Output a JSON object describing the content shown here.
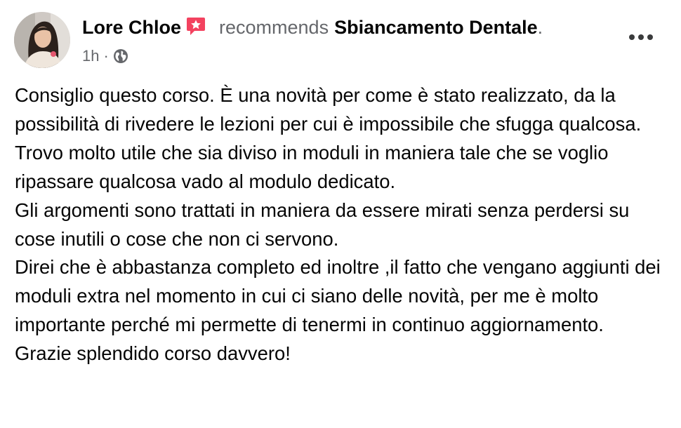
{
  "post": {
    "author": "Lore Chloe",
    "action": "recommends",
    "page": "Sbiancamento Dentale",
    "period": ".",
    "time": "1h",
    "separator": "·",
    "audience_icon": "globe-icon",
    "badge_icon": "recommend-badge-icon",
    "more_icon": "more-options-icon",
    "paragraphs": [
      "Consiglio questo corso. È una novità per come è stato realizzato, da la possibilità di rivedere le lezioni per cui è impossibile che sfugga qualcosa.",
      "Trovo molto utile che sia diviso in moduli in maniera tale che se voglio ripassare qualcosa vado al modulo dedicato.",
      "Gli argomenti sono trattati in maniera da essere mirati senza perdersi su cose inutili o cose che non ci servono.",
      "Direi che è abbastanza completo ed inoltre ,il fatto che vengano aggiunti dei moduli extra nel momento in cui ci siano delle novità, per me è molto importante perché mi permette di tenermi in continuo aggiornamento.",
      "Grazie splendido corso davvero!"
    ]
  },
  "colors": {
    "text_primary": "#050505",
    "text_secondary": "#65676b",
    "badge": "#f3425f"
  }
}
